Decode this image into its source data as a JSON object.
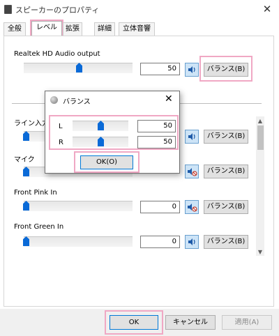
{
  "window": {
    "title": "スピーカーのプロパティ",
    "close_glyph": "✕"
  },
  "tabs": [
    {
      "label": "全般"
    },
    {
      "label": "レベル"
    },
    {
      "label": "拡張"
    },
    {
      "label": "詳細"
    },
    {
      "label": "立体音響"
    }
  ],
  "main_device": {
    "name": "Realtek HD Audio output",
    "value": "50",
    "balance_label": "バランス(B)",
    "level": 0.5
  },
  "devices": [
    {
      "name": "ライン入力",
      "value": "",
      "balance_label": "バランス(B)",
      "muted": false,
      "level": 0.0
    },
    {
      "name": "マイク",
      "value": "",
      "balance_label": "バランス(B)",
      "muted": true,
      "level": 0.0
    },
    {
      "name": "Front Pink In",
      "value": "0",
      "balance_label": "バランス(B)",
      "muted": true,
      "level": 0.0
    },
    {
      "name": "Front Green In",
      "value": "0",
      "balance_label": "バランス(B)",
      "muted": false,
      "level": 0.0
    }
  ],
  "balance_dialog": {
    "title": "バランス",
    "close_glyph": "✕",
    "left": {
      "label": "L",
      "value": "50",
      "level": 0.5
    },
    "right": {
      "label": "R",
      "value": "50",
      "level": 0.5
    },
    "ok_label": "OK(O)"
  },
  "footer": {
    "ok_label": "OK",
    "cancel_label": "キャンセル",
    "apply_label": "適用(A)"
  },
  "colors": {
    "highlight": "#f0a8c4",
    "thumb": "#0a6ad7",
    "accent_border": "#0078d7"
  }
}
